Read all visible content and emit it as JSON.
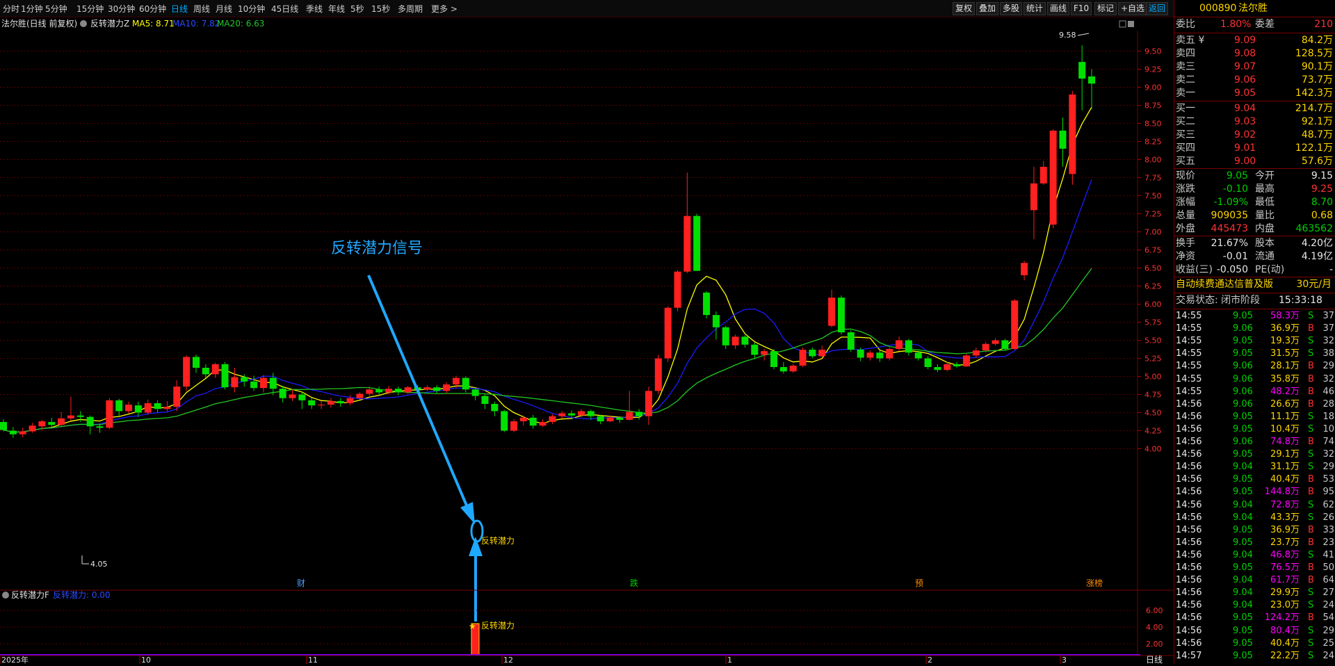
{
  "toolbar": {
    "periods": [
      "分时",
      "1分钟",
      "5分钟",
      "15分钟",
      "30分钟",
      "60分钟",
      "日线",
      "周线",
      "月线",
      "10分钟",
      "45日线",
      "季线",
      "年线",
      "5秒",
      "15秒",
      "多周期",
      "更多 >"
    ],
    "active_period": "日线",
    "right_buttons": [
      "复权",
      "叠加",
      "多股",
      "统计",
      "画线",
      "F10",
      "标记",
      "+自选",
      "返回"
    ]
  },
  "chart_header": {
    "stock_name": "法尔胜(日线 前复权)",
    "indicator_name": "反转潜力Z",
    "ma5": "MA5: 8.71",
    "ma10": "MA10: 7.82",
    "ma20": "MA20: 6.63"
  },
  "sub_header": {
    "name": "反转潜力F",
    "value": "反转潜力: 0.00"
  },
  "annotation": {
    "text": "反转潜力信号"
  },
  "signal_label": "反转潜力",
  "event_markers": [
    "财",
    "跌",
    "预",
    "涨榜"
  ],
  "price_axis": [
    "9.50",
    "9.25",
    "9.00",
    "8.75",
    "8.50",
    "8.25",
    "8.00",
    "7.75",
    "7.50",
    "7.25",
    "7.00",
    "6.75",
    "6.50",
    "6.25",
    "6.00",
    "5.75",
    "5.50",
    "5.25",
    "5.00",
    "4.75",
    "4.50",
    "4.25",
    "4.00"
  ],
  "sub_axis": [
    "6.00",
    "4.00",
    "2.00"
  ],
  "time_axis": [
    "2025年",
    "10",
    "11",
    "12",
    "1",
    "2",
    "3"
  ],
  "period_label": "日线",
  "high_mark": "9.58",
  "low_mark": "4.05",
  "chart_data": {
    "type": "candlestick",
    "title": "法尔胜(日线 前复权)",
    "ylim": [
      3.9,
      9.65
    ],
    "candles": [
      [
        4.37,
        4.26,
        4.41,
        4.24
      ],
      [
        4.25,
        4.2,
        4.3,
        4.15
      ],
      [
        4.2,
        4.24,
        4.29,
        4.16
      ],
      [
        4.24,
        4.32,
        4.36,
        4.22
      ],
      [
        4.31,
        4.38,
        4.4,
        4.26
      ],
      [
        4.37,
        4.33,
        4.43,
        4.28
      ],
      [
        4.33,
        4.42,
        4.51,
        4.31
      ],
      [
        4.42,
        4.46,
        4.72,
        4.39
      ],
      [
        4.46,
        4.44,
        4.52,
        4.37
      ],
      [
        4.44,
        4.31,
        4.46,
        4.2
      ],
      [
        4.31,
        4.29,
        4.35,
        4.22
      ],
      [
        4.29,
        4.67,
        4.7,
        4.27
      ],
      [
        4.67,
        4.52,
        4.69,
        4.45
      ],
      [
        4.52,
        4.61,
        4.65,
        4.49
      ],
      [
        4.6,
        4.5,
        4.65,
        4.44
      ],
      [
        4.5,
        4.63,
        4.68,
        4.47
      ],
      [
        4.63,
        4.55,
        4.67,
        4.5
      ],
      [
        4.55,
        4.58,
        4.66,
        4.52
      ],
      [
        4.58,
        4.86,
        4.95,
        4.52
      ],
      [
        4.86,
        5.27,
        5.29,
        4.8
      ],
      [
        5.27,
        5.12,
        5.3,
        5.05
      ],
      [
        5.12,
        5.03,
        5.17,
        4.98
      ],
      [
        5.03,
        5.17,
        5.19,
        4.98
      ],
      [
        5.17,
        4.85,
        5.2,
        4.82
      ],
      [
        4.85,
        4.99,
        5.12,
        4.78
      ],
      [
        4.99,
        4.93,
        5.03,
        4.86
      ],
      [
        4.93,
        4.84,
        5.01,
        4.8
      ],
      [
        4.84,
        4.98,
        5.02,
        4.78
      ],
      [
        4.98,
        4.83,
        5.05,
        4.74
      ],
      [
        4.83,
        4.7,
        4.87,
        4.64
      ],
      [
        4.7,
        4.75,
        4.82,
        4.66
      ],
      [
        4.75,
        4.67,
        4.79,
        4.55
      ],
      [
        4.67,
        4.6,
        4.7,
        4.55
      ],
      [
        4.6,
        4.61,
        4.66,
        4.55
      ],
      [
        4.61,
        4.66,
        4.7,
        4.57
      ],
      [
        4.66,
        4.63,
        4.7,
        4.58
      ],
      [
        4.63,
        4.7,
        4.74,
        4.6
      ],
      [
        4.7,
        4.76,
        4.78,
        4.68
      ],
      [
        4.76,
        4.82,
        4.86,
        4.73
      ],
      [
        4.82,
        4.78,
        4.86,
        4.74
      ],
      [
        4.78,
        4.83,
        4.87,
        4.75
      ],
      [
        4.83,
        4.78,
        4.86,
        4.74
      ],
      [
        4.78,
        4.85,
        4.87,
        4.76
      ],
      [
        4.85,
        4.82,
        4.88,
        4.78
      ],
      [
        4.82,
        4.85,
        4.88,
        4.8
      ],
      [
        4.85,
        4.8,
        4.88,
        4.76
      ],
      [
        4.8,
        4.89,
        4.92,
        4.77
      ],
      [
        4.89,
        4.98,
        5.01,
        4.84
      ],
      [
        4.98,
        4.82,
        5.0,
        4.78
      ],
      [
        4.82,
        4.73,
        4.85,
        4.67
      ],
      [
        4.73,
        4.62,
        4.75,
        4.55
      ],
      [
        4.62,
        4.52,
        4.65,
        4.45
      ],
      [
        4.52,
        4.25,
        4.54,
        4.23
      ],
      [
        4.25,
        4.38,
        4.41,
        4.23
      ],
      [
        4.38,
        4.43,
        4.46,
        4.32
      ],
      [
        4.43,
        4.32,
        4.47,
        4.28
      ],
      [
        4.32,
        4.37,
        4.41,
        4.3
      ],
      [
        4.37,
        4.45,
        4.48,
        4.34
      ],
      [
        4.45,
        4.49,
        4.52,
        4.42
      ],
      [
        4.49,
        4.46,
        4.53,
        4.43
      ],
      [
        4.46,
        4.52,
        4.55,
        4.44
      ],
      [
        4.52,
        4.45,
        4.54,
        4.4
      ],
      [
        4.45,
        4.38,
        4.47,
        4.34
      ],
      [
        4.38,
        4.43,
        4.46,
        4.37
      ],
      [
        4.43,
        4.4,
        4.45,
        4.36
      ],
      [
        4.4,
        4.51,
        4.8,
        4.39
      ],
      [
        4.51,
        4.45,
        4.55,
        4.4
      ],
      [
        4.45,
        4.8,
        4.86,
        4.33
      ],
      [
        4.8,
        5.25,
        5.3,
        4.76
      ],
      [
        5.25,
        5.95,
        5.97,
        5.2
      ],
      [
        5.95,
        6.45,
        6.47,
        5.9
      ],
      [
        6.45,
        7.22,
        7.82,
        6.43
      ],
      [
        7.22,
        6.46,
        7.25,
        6.46
      ],
      [
        6.16,
        5.85,
        6.18,
        5.8
      ],
      [
        5.85,
        5.68,
        5.9,
        5.51
      ],
      [
        5.68,
        5.43,
        5.7,
        5.38
      ],
      [
        5.43,
        5.55,
        5.58,
        5.38
      ],
      [
        5.55,
        5.44,
        5.57,
        5.4
      ],
      [
        5.44,
        5.3,
        5.47,
        5.24
      ],
      [
        5.3,
        5.35,
        5.38,
        5.22
      ],
      [
        5.35,
        5.13,
        5.38,
        5.1
      ],
      [
        5.13,
        5.07,
        5.2,
        5.04
      ],
      [
        5.07,
        5.15,
        5.17,
        5.05
      ],
      [
        5.15,
        5.37,
        5.4,
        5.13
      ],
      [
        5.37,
        5.28,
        5.4,
        5.25
      ],
      [
        5.28,
        5.37,
        5.43,
        5.27
      ],
      [
        5.7,
        6.09,
        6.2,
        5.68
      ],
      [
        6.09,
        5.61,
        6.12,
        5.58
      ],
      [
        5.61,
        5.37,
        5.64,
        5.34
      ],
      [
        5.37,
        5.26,
        5.4,
        5.21
      ],
      [
        5.26,
        5.33,
        5.36,
        5.22
      ],
      [
        5.33,
        5.25,
        5.36,
        5.2
      ],
      [
        5.25,
        5.38,
        5.4,
        5.22
      ],
      [
        5.38,
        5.5,
        5.55,
        5.35
      ],
      [
        5.5,
        5.33,
        5.52,
        5.29
      ],
      [
        5.33,
        5.25,
        5.36,
        5.22
      ],
      [
        5.25,
        5.13,
        5.28,
        5.1
      ],
      [
        5.13,
        5.09,
        5.17,
        5.06
      ],
      [
        5.09,
        5.17,
        5.2,
        5.07
      ],
      [
        5.17,
        5.14,
        5.2,
        5.12
      ],
      [
        5.14,
        5.29,
        5.31,
        5.13
      ],
      [
        5.29,
        5.36,
        5.4,
        5.26
      ],
      [
        5.36,
        5.45,
        5.48,
        5.33
      ],
      [
        5.45,
        5.5,
        5.53,
        5.43
      ],
      [
        5.5,
        5.38,
        5.52,
        5.36
      ],
      [
        5.38,
        6.05,
        6.07,
        5.37
      ],
      [
        6.4,
        6.57,
        6.6,
        6.33
      ],
      [
        7.3,
        7.67,
        7.9,
        6.9
      ],
      [
        7.67,
        7.9,
        7.98,
        7.65
      ],
      [
        7.1,
        8.4,
        8.42,
        7.05
      ],
      [
        8.4,
        8.15,
        8.58,
        7.9
      ],
      [
        7.8,
        8.9,
        8.95,
        7.65
      ],
      [
        9.35,
        9.12,
        9.58,
        8.68
      ],
      [
        9.15,
        9.05,
        9.25,
        8.7
      ]
    ],
    "ma5_last": 8.71,
    "ma10_last": 7.82,
    "ma20_last": 6.63
  },
  "quote": {
    "code": "000890",
    "name": "法尔胜",
    "weibi_label": "委比",
    "weibi": "1.80%",
    "weicha_label": "委差",
    "weicha": "210",
    "sells": [
      {
        "label": "卖五 ¥",
        "price": "9.09",
        "vol": "84.2万"
      },
      {
        "label": "卖四",
        "price": "9.08",
        "vol": "128.5万"
      },
      {
        "label": "卖三",
        "price": "9.07",
        "vol": "90.1万"
      },
      {
        "label": "卖二",
        "price": "9.06",
        "vol": "73.7万"
      },
      {
        "label": "卖一",
        "price": "9.05",
        "vol": "142.3万"
      }
    ],
    "buys": [
      {
        "label": "买一",
        "price": "9.04",
        "vol": "214.7万"
      },
      {
        "label": "买二",
        "price": "9.03",
        "vol": "92.1万"
      },
      {
        "label": "买三",
        "price": "9.02",
        "vol": "48.7万"
      },
      {
        "label": "买四",
        "price": "9.01",
        "vol": "122.1万"
      },
      {
        "label": "买五",
        "price": "9.00",
        "vol": "57.6万"
      }
    ],
    "stats": [
      {
        "l1": "现价",
        "v1": "9.05",
        "c1": "grn",
        "l2": "今开",
        "v2": "9.15",
        "c2": "wht"
      },
      {
        "l1": "涨跌",
        "v1": "-0.10",
        "c1": "grn",
        "l2": "最高",
        "v2": "9.25",
        "c2": "red"
      },
      {
        "l1": "涨幅",
        "v1": "-1.09%",
        "c1": "grn",
        "l2": "最低",
        "v2": "8.70",
        "c2": "grn"
      },
      {
        "l1": "总量",
        "v1": "909035",
        "c1": "yel",
        "l2": "量比",
        "v2": "0.68",
        "c2": "yel"
      },
      {
        "l1": "外盘",
        "v1": "445473",
        "c1": "red",
        "l2": "内盘",
        "v2": "463562",
        "c2": "grn"
      }
    ],
    "stats2": [
      {
        "l1": "换手",
        "v1": "21.67%",
        "l2": "股本",
        "v2": "4.20亿"
      },
      {
        "l1": "净资",
        "v1": "-0.01",
        "l2": "流通",
        "v2": "4.19亿"
      },
      {
        "l1": "收益(三)",
        "v1": "-0.050",
        "l2": "PE(动)",
        "v2": "-"
      }
    ],
    "ad_text": "自动续费通达信普及版",
    "ad_price": "30元/月",
    "trade_status": "交易状态: 闭市阶段",
    "trade_time": "15:33:18"
  },
  "ticks": [
    {
      "t": "14:55",
      "p": "9.05",
      "v": "58.3万",
      "d": "S",
      "n": "37"
    },
    {
      "t": "14:55",
      "p": "9.06",
      "v": "36.9万",
      "d": "B",
      "n": "37"
    },
    {
      "t": "14:55",
      "p": "9.05",
      "v": "19.3万",
      "d": "S",
      "n": "32"
    },
    {
      "t": "14:55",
      "p": "9.05",
      "v": "31.5万",
      "d": "S",
      "n": "38"
    },
    {
      "t": "14:55",
      "p": "9.06",
      "v": "28.1万",
      "d": "B",
      "n": "29"
    },
    {
      "t": "14:55",
      "p": "9.06",
      "v": "35.8万",
      "d": "B",
      "n": "32"
    },
    {
      "t": "14:55",
      "p": "9.06",
      "v": "48.2万",
      "d": "B",
      "n": "46"
    },
    {
      "t": "14:56",
      "p": "9.06",
      "v": "26.6万",
      "d": "B",
      "n": "28"
    },
    {
      "t": "14:56",
      "p": "9.05",
      "v": "11.1万",
      "d": "S",
      "n": "18"
    },
    {
      "t": "14:56",
      "p": "9.05",
      "v": "10.4万",
      "d": "S",
      "n": "10"
    },
    {
      "t": "14:56",
      "p": "9.06",
      "v": "74.8万",
      "d": "B",
      "n": "74"
    },
    {
      "t": "14:56",
      "p": "9.05",
      "v": "29.1万",
      "d": "S",
      "n": "32"
    },
    {
      "t": "14:56",
      "p": "9.04",
      "v": "31.1万",
      "d": "S",
      "n": "29"
    },
    {
      "t": "14:56",
      "p": "9.05",
      "v": "40.4万",
      "d": "B",
      "n": "53"
    },
    {
      "t": "14:56",
      "p": "9.05",
      "v": "144.8万",
      "d": "B",
      "n": "95"
    },
    {
      "t": "14:56",
      "p": "9.04",
      "v": "72.8万",
      "d": "S",
      "n": "62"
    },
    {
      "t": "14:56",
      "p": "9.04",
      "v": "43.3万",
      "d": "S",
      "n": "26"
    },
    {
      "t": "14:56",
      "p": "9.05",
      "v": "36.9万",
      "d": "B",
      "n": "33"
    },
    {
      "t": "14:56",
      "p": "9.05",
      "v": "23.7万",
      "d": "B",
      "n": "23"
    },
    {
      "t": "14:56",
      "p": "9.04",
      "v": "46.8万",
      "d": "S",
      "n": "41"
    },
    {
      "t": "14:56",
      "p": "9.05",
      "v": "76.5万",
      "d": "B",
      "n": "50"
    },
    {
      "t": "14:56",
      "p": "9.04",
      "v": "61.7万",
      "d": "B",
      "n": "64"
    },
    {
      "t": "14:56",
      "p": "9.04",
      "v": "29.9万",
      "d": "S",
      "n": "27"
    },
    {
      "t": "14:56",
      "p": "9.04",
      "v": "23.0万",
      "d": "S",
      "n": "24"
    },
    {
      "t": "14:56",
      "p": "9.05",
      "v": "124.2万",
      "d": "B",
      "n": "54"
    },
    {
      "t": "14:56",
      "p": "9.05",
      "v": "80.4万",
      "d": "S",
      "n": "29"
    },
    {
      "t": "14:56",
      "p": "9.05",
      "v": "40.4万",
      "d": "S",
      "n": "25"
    },
    {
      "t": "14:57",
      "p": "9.05",
      "v": "22.2万",
      "d": "S",
      "n": "24"
    }
  ],
  "colors": {
    "up": "#ff2020",
    "down": "#00e000",
    "ma5": "#ffff00",
    "ma10": "#1c1cff",
    "ma20": "#22c822",
    "annotation": "#1fa8ff"
  }
}
